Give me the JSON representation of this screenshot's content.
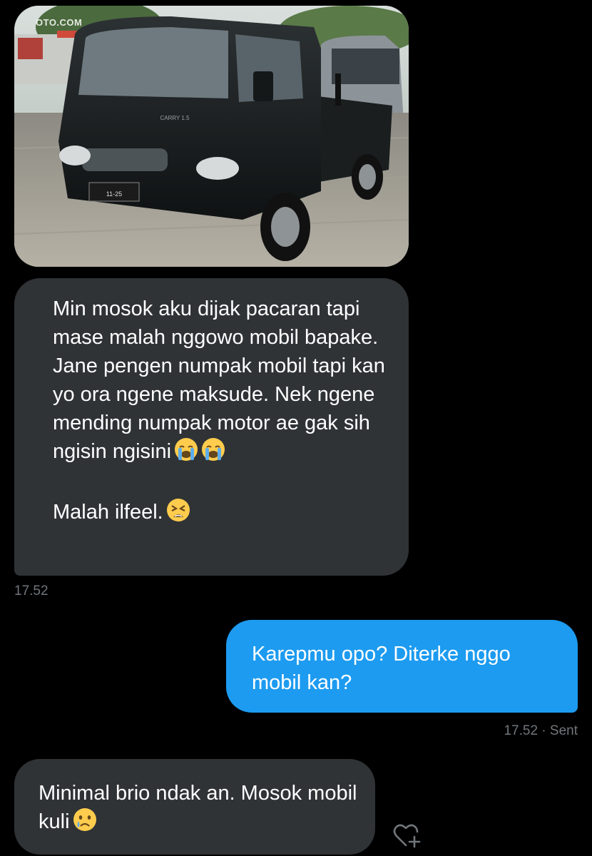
{
  "conversation": {
    "image_message": {
      "watermark": "OTO.COM",
      "plate_text": "11-25",
      "badge_text": "CARRY 1.5"
    },
    "received_1": {
      "paragraph_1": "Min mosok aku dijak pacaran tapi mase malah nggowo mobil bapake. Jane pengen numpak mobil tapi kan yo ora ngene maksude. Nek ngene mending numpak motor ae gak sih ngisin ngisini",
      "paragraph_2": "Malah ilfeel.",
      "emoji_1": "loudly-crying-face",
      "emoji_2": "tired-face",
      "timestamp": "17.52"
    },
    "sent_1": {
      "text": "Karepmu opo? Diterke nggo mobil kan?",
      "timestamp": "17.52",
      "status": " · Sent"
    },
    "received_2": {
      "text": "Minimal brio ndak an. Mosok mobil kuli",
      "emoji": "crying-face"
    }
  },
  "colors": {
    "background": "#000000",
    "received_bubble": "#2f3336",
    "sent_bubble": "#1d9bf0",
    "timestamp": "#71767b"
  },
  "icons": {
    "reaction": "heart-plus-icon"
  }
}
